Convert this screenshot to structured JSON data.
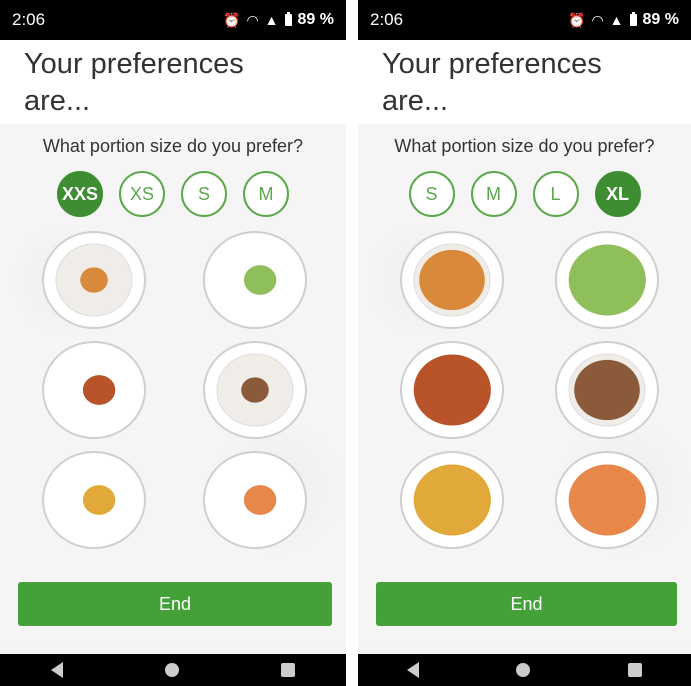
{
  "status": {
    "time": "2:06",
    "alarm_icon": "alarm-icon",
    "wifi_icon": "wifi-icon",
    "signal_icon": "signal-icon",
    "battery_icon": "battery-icon",
    "battery": "89 %"
  },
  "title_line1": "Your preferences",
  "title_line2": "are...",
  "question": "What portion size do you prefer?",
  "end_label": "End",
  "colors": {
    "accent": "#43a138",
    "selected": "#3e8d33",
    "outline": "#5aa84a"
  },
  "screens": [
    {
      "sizes": [
        "XXS",
        "XS",
        "S",
        "M"
      ],
      "selected": "XXS",
      "portion_level": 0.15
    },
    {
      "sizes": [
        "S",
        "M",
        "L",
        "XL"
      ],
      "selected": "XL",
      "portion_level": 0.95
    }
  ],
  "dishes": [
    {
      "name": "noodle-soup",
      "type": "bowl",
      "color": "#d9893a"
    },
    {
      "name": "salad",
      "type": "plate",
      "color": "#8fbf5a"
    },
    {
      "name": "rice-dish",
      "type": "plate",
      "color": "#b8532a"
    },
    {
      "name": "lentil-stew",
      "type": "bowl",
      "color": "#8a5a3a"
    },
    {
      "name": "potatoes",
      "type": "plate",
      "color": "#e0a93a"
    },
    {
      "name": "ravioli",
      "type": "plate",
      "color": "#e8874a"
    }
  ]
}
